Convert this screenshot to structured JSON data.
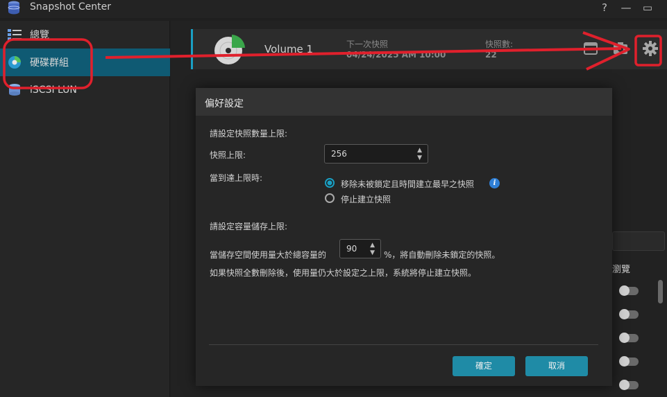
{
  "window": {
    "title": "Snapshot Center",
    "help_icon": "?",
    "minimize_icon": "—",
    "maximize_icon": "▭"
  },
  "sidebar": {
    "items": [
      {
        "label": "總覽",
        "icon": "overview-list-icon"
      },
      {
        "label": "硬碟群組",
        "icon": "disk-group-icon",
        "active": true
      },
      {
        "label": "iSCSI LUN",
        "icon": "iscsi-lun-icon"
      }
    ]
  },
  "volume_card": {
    "name": "Volume 1",
    "next_snapshot_label": "下一次快照",
    "next_snapshot_value": "04/24/2025 AM 10:00",
    "snapshot_count_label": "快照數:",
    "snapshot_count_value": "22"
  },
  "right_panel": {
    "column_header": "瀏覽"
  },
  "dialog": {
    "title": "偏好設定",
    "section_count": "請設定快照數量上限:",
    "limit_label": "快照上限:",
    "limit_value": "256",
    "when_reached_label": "當到達上限時:",
    "option_remove": "移除未被鎖定且時間建立最早之快照",
    "option_stop": "停止建立快照",
    "section_capacity": "請設定容量儲存上限:",
    "capacity_prefix": "當儲存空間使用量大於總容量的",
    "capacity_value": "90",
    "capacity_suffix": "%，將自動刪除未鎖定的快照。",
    "capacity_note": "如果快照全數刪除後，使用量仍大於設定之上限，系統將停止建立快照。",
    "ok_label": "確定",
    "cancel_label": "取消"
  },
  "colors": {
    "accent": "#1aa0c4",
    "active_nav": "#0f5a73",
    "annotation": "#e0202c",
    "button": "#1f8ba6"
  }
}
